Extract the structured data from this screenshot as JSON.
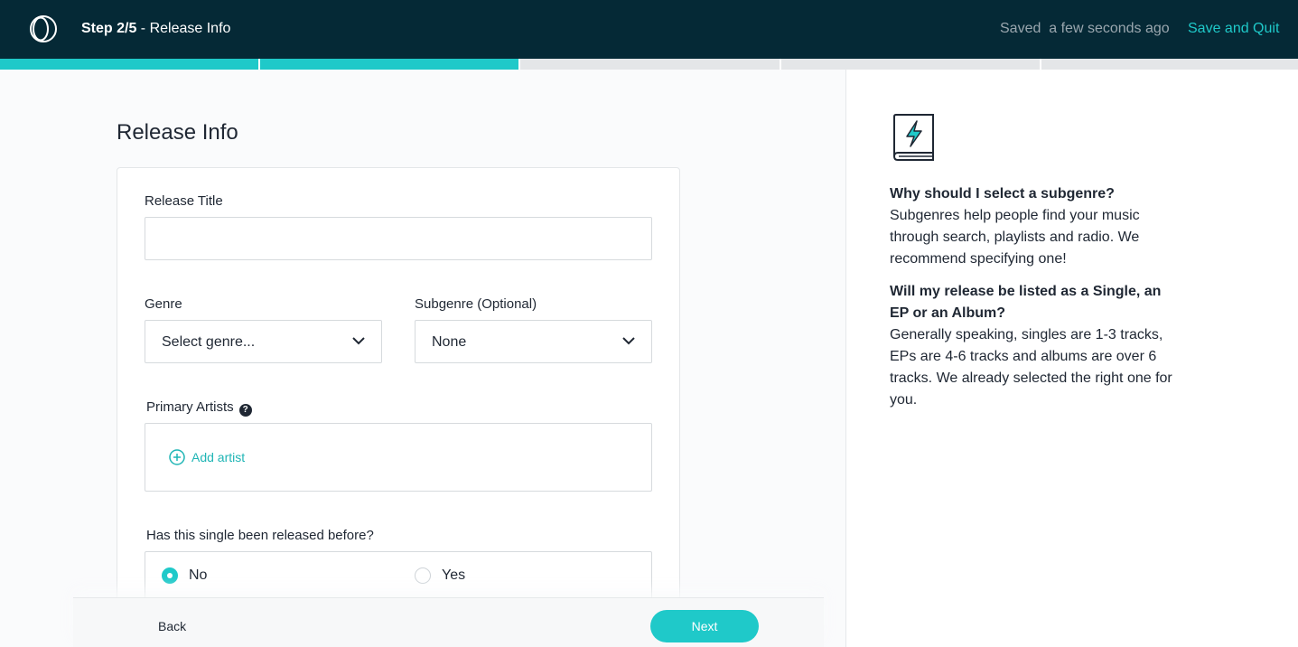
{
  "header": {
    "step_prefix": "Step 2/5",
    "step_suffix": " - Release Info",
    "saved_status": "Saved  a few seconds ago",
    "save_quit_label": "Save and Quit"
  },
  "progress": {
    "total_steps": 5,
    "completed_steps": 2,
    "accent": "#1fc9c9"
  },
  "form": {
    "page_title": "Release Info",
    "release_title": {
      "label": "Release Title",
      "value": "",
      "placeholder": ""
    },
    "genre": {
      "label": "Genre",
      "selected": "Select genre..."
    },
    "subgenre": {
      "label": "Subgenre (Optional)",
      "selected": "None"
    },
    "primary_artists": {
      "label": "Primary Artists",
      "add_label": "Add artist"
    },
    "released_before": {
      "question": "Has this single been released before?",
      "options": [
        {
          "label": "No",
          "selected": true
        },
        {
          "label": "Yes",
          "selected": false
        }
      ]
    }
  },
  "footer": {
    "back_label": "Back",
    "next_label": "Next"
  },
  "sidebar": {
    "faqs": [
      {
        "question": "Why should I select a subgenre?",
        "answer": "Subgenres help people find your music through search, playlists and radio. We recommend specifying one!"
      },
      {
        "question": "Will my release be listed as a Single, an EP or an Album?",
        "answer": "Generally speaking, singles are 1-3 tracks, EPs are 4-6 tracks and albums are over 6 tracks. We already selected the right one for you."
      }
    ]
  },
  "colors": {
    "header_bg": "#052936",
    "accent": "#1fc9c9",
    "text": "#1f2733"
  }
}
